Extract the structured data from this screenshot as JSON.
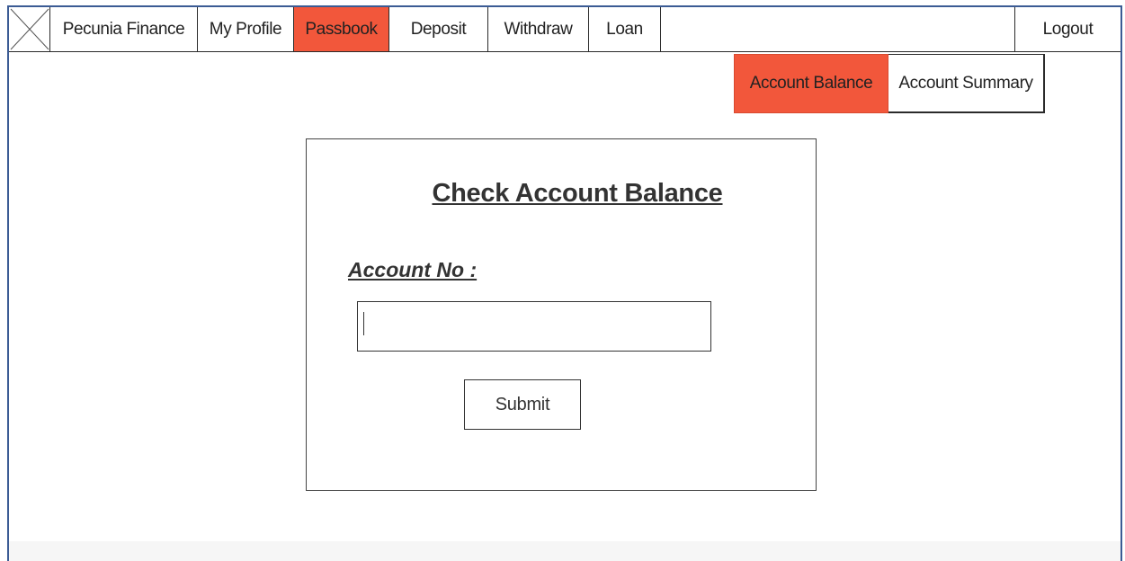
{
  "navbar": {
    "logo_icon": "image-placeholder-icon",
    "items": [
      {
        "label": "Pecunia Finance",
        "active": false
      },
      {
        "label": "My Profile",
        "active": false
      },
      {
        "label": "Passbook",
        "active": true
      },
      {
        "label": "Deposit",
        "active": false
      },
      {
        "label": "Withdraw",
        "active": false
      },
      {
        "label": "Loan",
        "active": false
      }
    ],
    "logout_label": "Logout"
  },
  "subtabs": [
    {
      "label": "Account Balance",
      "active": true
    },
    {
      "label": "Account Summary",
      "active": false
    }
  ],
  "card": {
    "title": "Check Account Balance",
    "account_label": "Account No :",
    "account_value": "",
    "submit_label": "Submit"
  },
  "colors": {
    "accent": "#f2573b",
    "frame_border": "#3b5b94"
  }
}
